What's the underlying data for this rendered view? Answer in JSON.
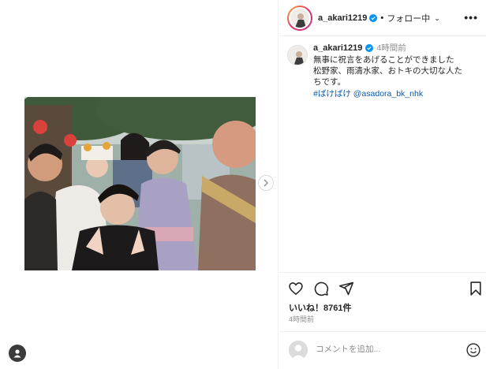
{
  "post": {
    "username": "a_akari1219",
    "follow_state": "フォロー中",
    "separator": "•"
  },
  "caption": {
    "username": "a_akari1219",
    "time_ago": "4時間前",
    "lines": [
      "無事に祝言をあげることができました",
      "松野家、雨清水家、おトキの大切な人た",
      "ちです。"
    ],
    "hashtag": "#ばけばけ",
    "mention": "@asadora_bk_nhk"
  },
  "actions": {
    "like_icon": "heart-icon",
    "comment_icon": "comment-icon",
    "share_icon": "share-icon",
    "save_icon": "bookmark-icon"
  },
  "stats": {
    "likes_text": "いいね！8761件",
    "posted_time": "4時間前"
  },
  "comment": {
    "placeholder": "コメントを追加..."
  },
  "colors": {
    "verified": "#0095f6",
    "link": "#00376b",
    "muted": "#8e8e8e",
    "border": "#efefef"
  }
}
